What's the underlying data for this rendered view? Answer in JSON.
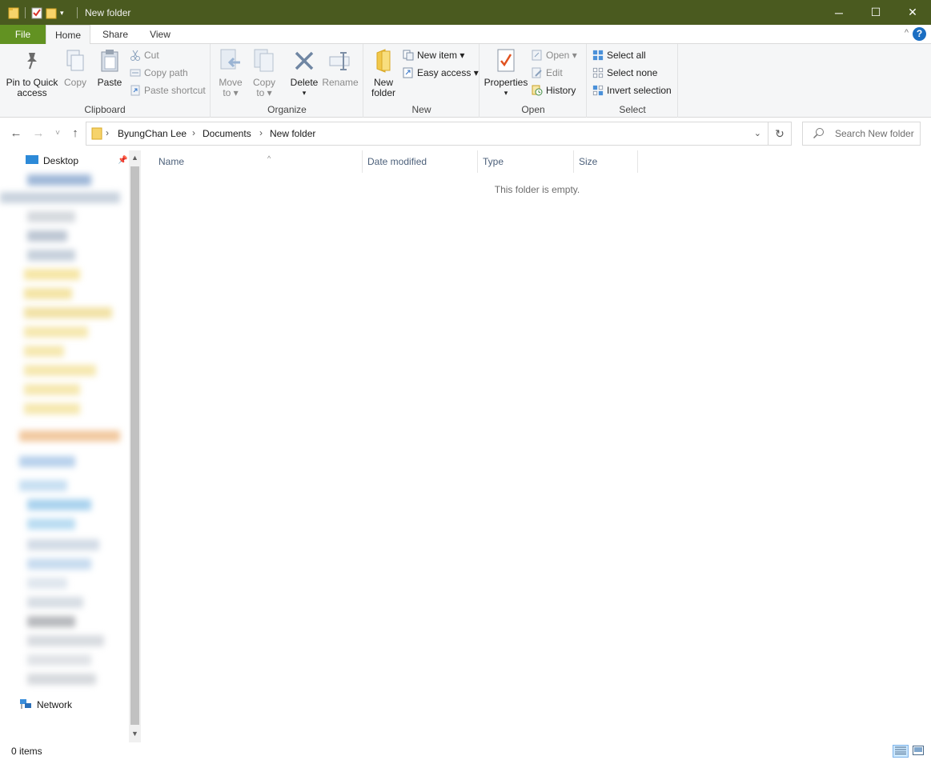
{
  "window": {
    "title": "New folder",
    "controls": {
      "minimize": "─",
      "maximize": "☐",
      "close": "✕"
    }
  },
  "ribbon_tabs": {
    "file": "File",
    "home": "Home",
    "share": "Share",
    "view": "View",
    "collapse": "^",
    "help": "?"
  },
  "ribbon": {
    "clipboard": {
      "label": "Clipboard",
      "pin_line1": "Pin to Quick",
      "pin_line2": "access",
      "copy": "Copy",
      "paste": "Paste",
      "cut": "Cut",
      "copy_path": "Copy path",
      "paste_shortcut": "Paste shortcut"
    },
    "organize": {
      "label": "Organize",
      "move_line1": "Move",
      "move_line2": "to ▾",
      "copy_line1": "Copy",
      "copy_line2": "to ▾",
      "delete": "Delete",
      "delete_arrow": "▾",
      "rename": "Rename"
    },
    "new": {
      "label": "New",
      "new_folder_line1": "New",
      "new_folder_line2": "folder",
      "new_item": "New item ▾",
      "easy_access": "Easy access ▾"
    },
    "open": {
      "label": "Open",
      "properties": "Properties",
      "properties_arrow": "▾",
      "open": "Open ▾",
      "edit": "Edit",
      "history": "History"
    },
    "select": {
      "label": "Select",
      "select_all": "Select all",
      "select_none": "Select none",
      "invert_selection": "Invert selection"
    }
  },
  "navigation": {
    "back": "←",
    "forward": "→",
    "recent": "˅",
    "up": "↑",
    "breadcrumb": [
      "ByungChan Lee",
      "Documents",
      "New folder"
    ],
    "separator": "›",
    "dropdown": "⌄",
    "refresh": "↻",
    "search_placeholder": "Search New folder"
  },
  "nav_pane": {
    "desktop": "Desktop",
    "network": "Network"
  },
  "columns": {
    "name": "Name",
    "date_modified": "Date modified",
    "type": "Type",
    "size": "Size",
    "sort_indicator": "^"
  },
  "content": {
    "empty_message": "This folder is empty."
  },
  "status": {
    "item_count": "0 items"
  },
  "colors": {
    "titlebar": "#4a5a1f",
    "file_tab": "#629222",
    "accent": "#1b6ec2"
  }
}
